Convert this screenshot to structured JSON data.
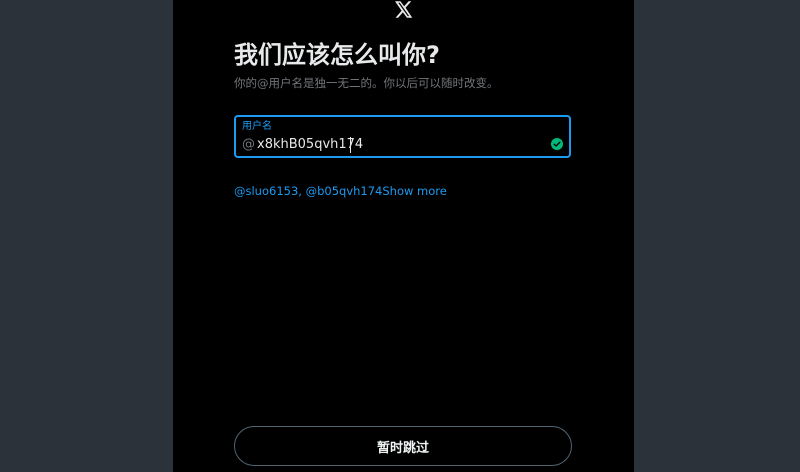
{
  "colors": {
    "backdrop": "#2b3239",
    "modal_background": "#000000",
    "accent": "#1d9bf0",
    "valid": "#00ba7c",
    "muted_text": "#71767b",
    "primary_text": "#e7e9ea"
  },
  "header": {
    "logo_icon": "x-logo-icon"
  },
  "main": {
    "title": "我们应该怎么叫你?",
    "subtitle": "你的@用户名是独一无二的。你以后可以随时改变。",
    "username_field": {
      "label": "用户名",
      "prefix": "@",
      "value": "x8khB05qvh174",
      "status_icon": "check-circle-icon"
    },
    "suggestions": {
      "items": [
        "@sluo6153",
        "@b05qvh174"
      ],
      "separator": ", ",
      "show_more": "Show more"
    }
  },
  "footer": {
    "skip_label": "暂时跳过"
  }
}
